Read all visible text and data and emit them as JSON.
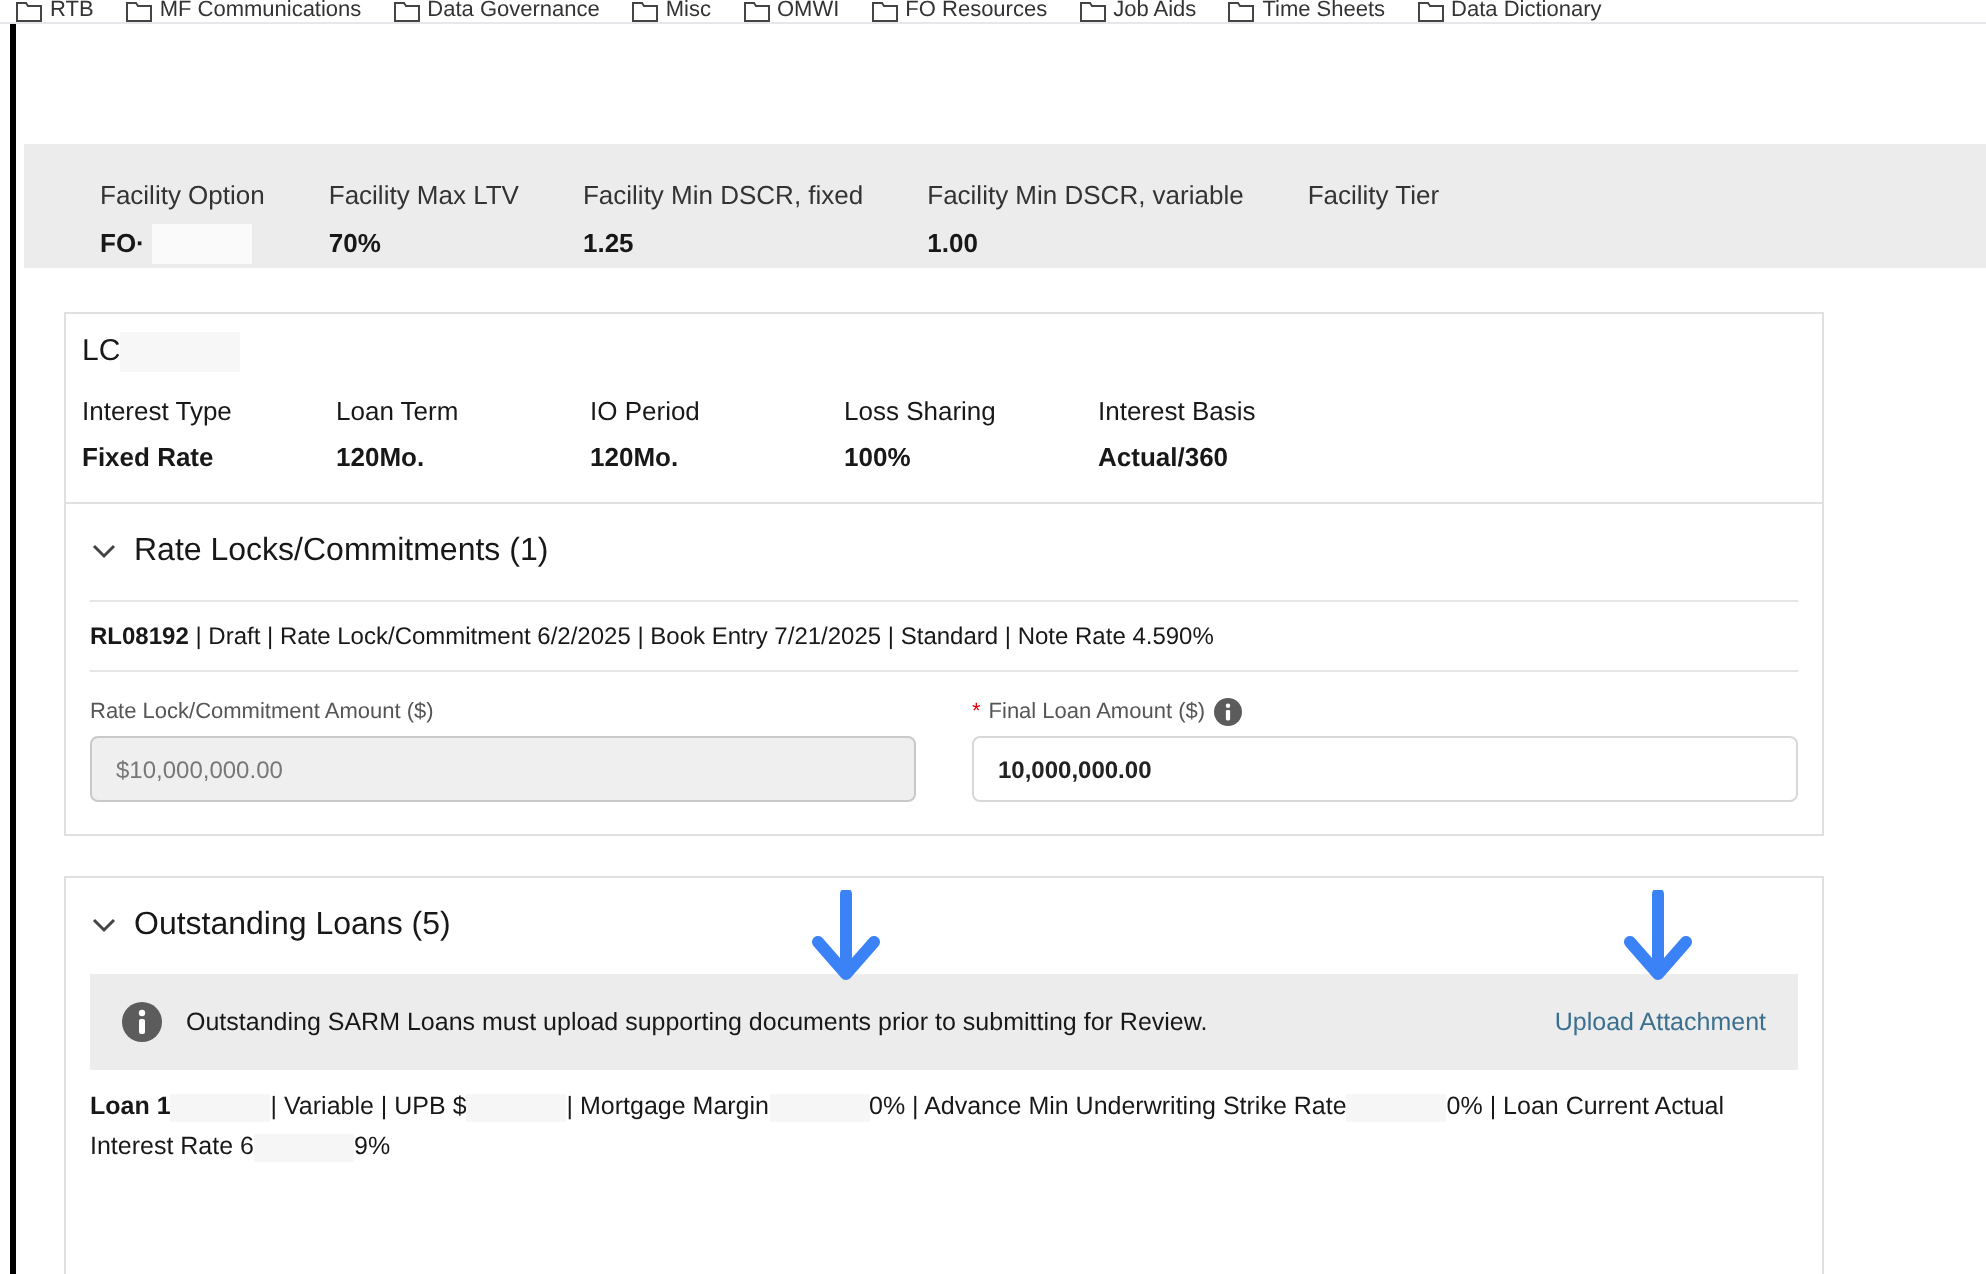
{
  "bookmarks": [
    "RTB",
    "MF Communications",
    "Data Governance",
    "Misc",
    "OMWI",
    "FO Resources",
    "Job Aids",
    "Time Sheets",
    "Data Dictionary"
  ],
  "facility": [
    {
      "label": "Facility Option",
      "value": "FO·",
      "redacted": true
    },
    {
      "label": "Facility Max LTV",
      "value": "70%",
      "redacted": false
    },
    {
      "label": "Facility Min DSCR, fixed",
      "value": "1.25",
      "redacted": false
    },
    {
      "label": "Facility Min DSCR, variable",
      "value": "1.00",
      "redacted": false
    },
    {
      "label": "Facility Tier",
      "redacted": false
    }
  ],
  "loan": {
    "title": "LC",
    "fields": [
      {
        "label": "Interest Type",
        "value": "Fixed Rate"
      },
      {
        "label": "Loan Term",
        "value": "120Mo."
      },
      {
        "label": "IO Period",
        "value": "120Mo."
      },
      {
        "label": "Loss Sharing",
        "value": "100%"
      },
      {
        "label": "Interest Basis",
        "value": "Actual/360"
      }
    ]
  },
  "rate_locks": {
    "title": "Rate Locks/Commitments (1)",
    "expanded": true,
    "summary": "**RL08192** | Draft | Rate Lock/Commitment 6/2/2025 | Book Entry 7/21/2025 | Standard | Note Rate 4.590%",
    "fields": [
      {
        "label": "Rate Lock/Commitment Amount ($)",
        "value": "$10,000,000.00",
        "disabled": true,
        "info": false
      },
      {
        "label": "Final Loan Amount ($)",
        "value": "10,000,000.00",
        "disabled": false,
        "required_mark": "*",
        "info": true
      }
    ]
  },
  "outstanding": {
    "title": "Outstanding Loans (5)",
    "expanded": true,
    "notice": "Outstanding SARM Loans must upload supporting documents prior to submitting for Review.",
    "link": "Upload Attachment",
    "loan_segments": [
      "**Loan 1**",
      "| Variable | UPB $",
      "| Mortgage Margin",
      "0% | Advance Min Underwriting Strike Rate",
      "0% | Loan Current Actual Interest Rate 6",
      "9%"
    ]
  }
}
